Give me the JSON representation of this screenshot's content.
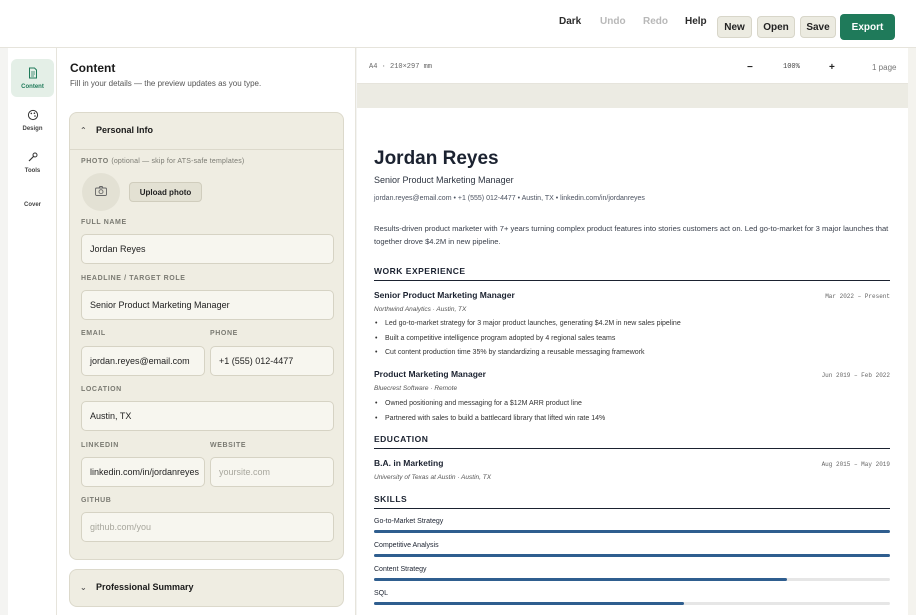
{
  "toolbar": {
    "dark": "Dark",
    "undo": "Undo",
    "redo": "Redo",
    "help": "Help",
    "new": "New",
    "open": "Open",
    "save": "Save",
    "export": "Export"
  },
  "rail": {
    "items": [
      {
        "label": "Content",
        "icon": "document-icon",
        "active": true
      },
      {
        "label": "Design",
        "icon": "palette-icon",
        "active": false
      },
      {
        "label": "Tools",
        "icon": "wrench-icon",
        "active": false
      },
      {
        "label": "Cover",
        "icon": "",
        "active": false
      }
    ]
  },
  "panel": {
    "title": "Content",
    "subtitle": "Fill in your details — the preview updates as you type.",
    "personal": {
      "heading": "Personal Info",
      "photo_label": "PHOTO",
      "photo_hint": "(optional — skip for ATS-safe templates)",
      "upload_label": "Upload photo",
      "full_name_label": "FULL NAME",
      "full_name_value": "Jordan Reyes",
      "headline_label": "HEADLINE / TARGET ROLE",
      "headline_value": "Senior Product Marketing Manager",
      "email_label": "EMAIL",
      "email_value": "jordan.reyes@email.com",
      "phone_label": "PHONE",
      "phone_value": "+1 (555) 012-4477",
      "location_label": "LOCATION",
      "location_value": "Austin, TX",
      "linkedin_label": "LINKEDIN",
      "linkedin_value": "linkedin.com/in/jordanreyes",
      "website_label": "WEBSITE",
      "website_placeholder": "yoursite.com",
      "github_label": "GITHUB",
      "github_placeholder": "github.com/you"
    },
    "summary": {
      "heading": "Professional Summary"
    }
  },
  "preview": {
    "page_size": "A4 · 210×297 mm",
    "zoom_minus": "−",
    "zoom": "100%",
    "zoom_plus": "+",
    "pages": "1 page"
  },
  "resume": {
    "name": "Jordan Reyes",
    "headline": "Senior Product Marketing Manager",
    "contact": "jordan.reyes@email.com  •  +1 (555) 012-4477  •  Austin, TX  •  linkedin.com/in/jordanreyes",
    "summary": "Results-driven product marketer with 7+ years turning complex product features into stories customers act on. Led go-to-market for 3 major launches that together drove $4.2M in new pipeline.",
    "work_heading": "WORK EXPERIENCE",
    "jobs": [
      {
        "title": "Senior Product Marketing Manager",
        "dates": "Mar 2022 – Present",
        "company": "Northwind Analytics · Austin, TX",
        "bullets": [
          "Led go-to-market strategy for 3 major product launches, generating $4.2M in new sales pipeline",
          "Built a competitive intelligence program adopted by 4 regional sales teams",
          "Cut content production time 35% by standardizing a reusable messaging framework"
        ]
      },
      {
        "title": "Product Marketing Manager",
        "dates": "Jun 2019 – Feb 2022",
        "company": "Bluecrest Software · Remote",
        "bullets": [
          "Owned positioning and messaging for a $12M ARR product line",
          "Partnered with sales to build a battlecard library that lifted win rate 14%"
        ]
      }
    ],
    "education_heading": "EDUCATION",
    "education": {
      "degree": "B.A. in Marketing",
      "dates": "Aug 2015 – May 2019",
      "school": "University of Texas at Austin · Austin, TX"
    },
    "skills_heading": "SKILLS",
    "skills": [
      {
        "name": "Go-to-Market Strategy",
        "level": 1.0
      },
      {
        "name": "Competitive Analysis",
        "level": 1.0
      },
      {
        "name": "Content Strategy",
        "level": 0.8
      },
      {
        "name": "SQL",
        "level": 0.6
      }
    ]
  },
  "colors": {
    "accent": "#1f7a5a",
    "skill_bar": "#2f5e8f",
    "card_bg": "#efede2"
  }
}
